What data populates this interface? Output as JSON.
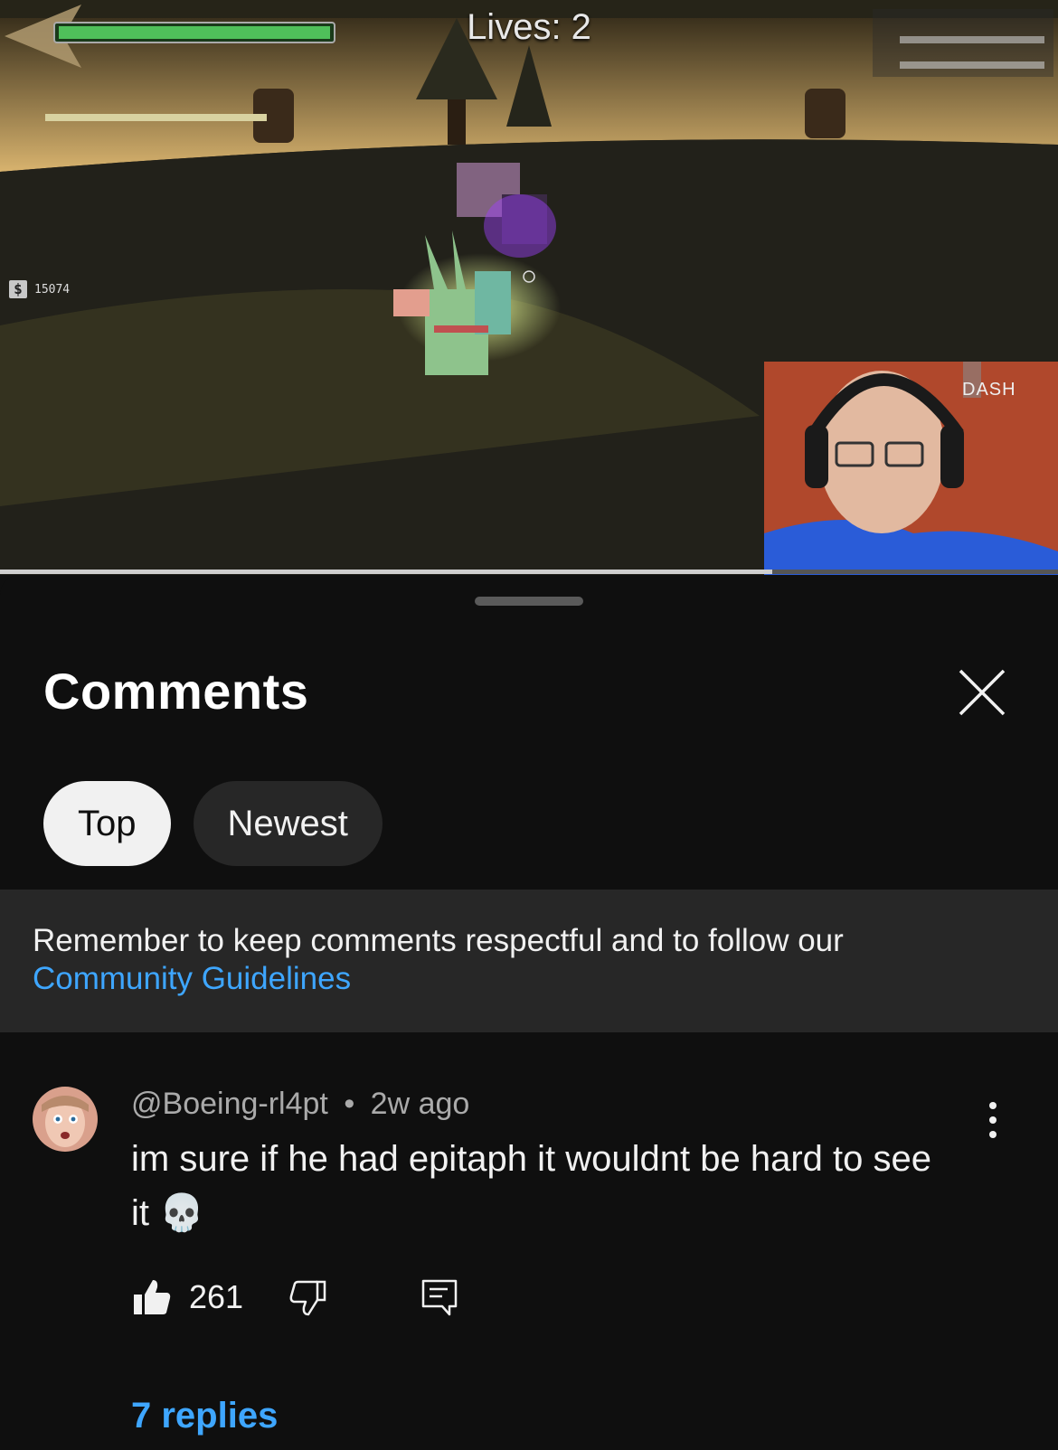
{
  "video": {
    "lives_text": "Lives: 2",
    "money": "15074",
    "money_symbol": "$",
    "dash_label": "DASH",
    "progress_fraction": 0.73
  },
  "sheet": {
    "title": "Comments",
    "chips": [
      {
        "label": "Top",
        "active": true
      },
      {
        "label": "Newest",
        "active": false
      }
    ],
    "notice_text": "Remember to keep comments respectful and to follow our",
    "notice_link": "Community Guidelines"
  },
  "comment": {
    "author": "@Boeing-rl4pt",
    "separator": "•",
    "time": "2w ago",
    "text": "im sure if he had epitaph it wouldnt be hard to see it 💀",
    "likes": "261",
    "replies_label": "7 replies"
  },
  "icons": {
    "close": "close-icon",
    "more": "more-vert-icon",
    "like": "thumbs-up-icon",
    "dislike": "thumbs-down-icon",
    "reply": "comment-reply-icon"
  },
  "colors": {
    "background": "#0f0f0f",
    "notice_bg": "#272727",
    "link": "#3ea6ff"
  }
}
